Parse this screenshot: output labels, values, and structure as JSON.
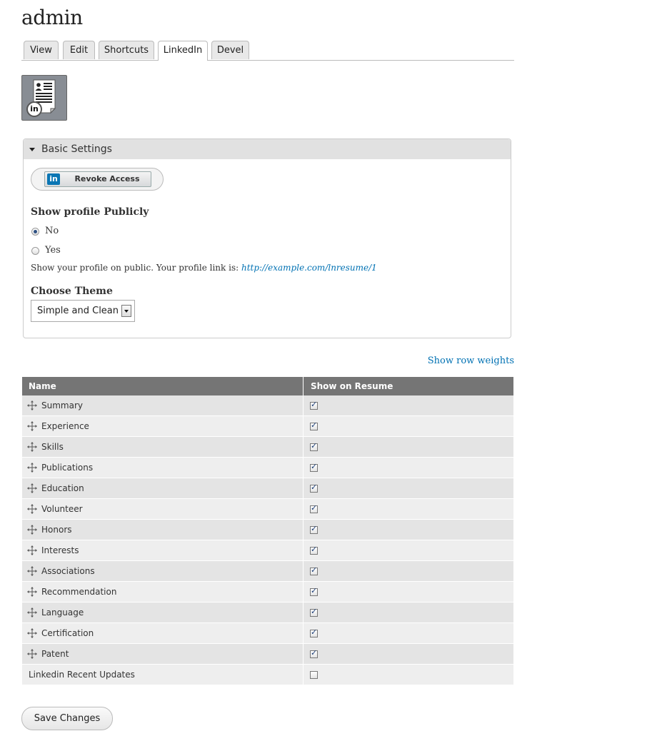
{
  "page": {
    "title": "admin"
  },
  "tabs": [
    {
      "label": "View",
      "active": false
    },
    {
      "label": "Edit",
      "active": false
    },
    {
      "label": "Shortcuts",
      "active": false
    },
    {
      "label": "LinkedIn",
      "active": true
    },
    {
      "label": "Devel",
      "active": false
    }
  ],
  "profile_icon": {
    "icon": "linkedin-resume-icon",
    "badge": "in"
  },
  "basic_settings": {
    "legend": "Basic Settings",
    "revoke_button": {
      "logo": "in",
      "label": "Revoke Access"
    },
    "show_profile": {
      "label": "Show profile Publicly",
      "options": [
        {
          "label": "No",
          "checked": true
        },
        {
          "label": "Yes",
          "checked": false
        }
      ],
      "description": "Show your profile on public. Your profile link is: ",
      "link": "http://example.com/lnresume/1"
    },
    "theme": {
      "label": "Choose Theme",
      "selected": "Simple and Clean"
    }
  },
  "show_row_weights": "Show row weights",
  "table": {
    "headers": [
      "Name",
      "Show on Resume"
    ],
    "rows": [
      {
        "name": "Summary",
        "draggable": true,
        "checked": true
      },
      {
        "name": "Experience",
        "draggable": true,
        "checked": true
      },
      {
        "name": "Skills",
        "draggable": true,
        "checked": true
      },
      {
        "name": "Publications",
        "draggable": true,
        "checked": true
      },
      {
        "name": "Education",
        "draggable": true,
        "checked": true
      },
      {
        "name": "Volunteer",
        "draggable": true,
        "checked": true
      },
      {
        "name": "Honors",
        "draggable": true,
        "checked": true
      },
      {
        "name": "Interests",
        "draggable": true,
        "checked": true
      },
      {
        "name": "Associations",
        "draggable": true,
        "checked": true
      },
      {
        "name": "Recommendation",
        "draggable": true,
        "checked": true
      },
      {
        "name": "Language",
        "draggable": true,
        "checked": true
      },
      {
        "name": "Certification",
        "draggable": true,
        "checked": true
      },
      {
        "name": "Patent",
        "draggable": true,
        "checked": true
      },
      {
        "name": "Linkedin Recent Updates",
        "draggable": false,
        "checked": false
      }
    ]
  },
  "save_button": "Save Changes",
  "colors": {
    "link": "#0071b3",
    "table_header": "#757575",
    "linkedin_blue": "#0a76b4"
  }
}
